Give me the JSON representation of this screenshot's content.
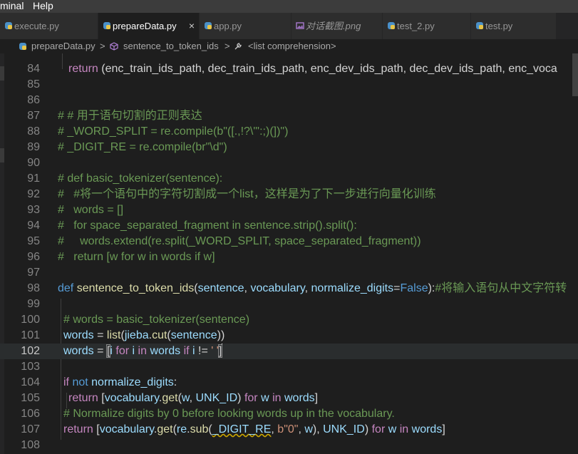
{
  "menu": {
    "terminal": "minal",
    "help": "Help"
  },
  "tabs": [
    {
      "label": "execute.py",
      "icon": "python-icon",
      "active": false
    },
    {
      "label": "prepareData.py",
      "icon": "python-icon",
      "active": true,
      "close": "×"
    },
    {
      "label": "app.py",
      "icon": "python-icon",
      "active": false
    },
    {
      "label": "对话截图.png",
      "icon": "image-file-icon",
      "active": false
    },
    {
      "label": "test_2.py",
      "icon": "python-icon",
      "active": false
    },
    {
      "label": "test.py",
      "icon": "python-icon",
      "active": false
    }
  ],
  "breadcrumb": {
    "file": "prepareData.py",
    "sep1": ">",
    "symbol": "sentence_to_token_ids",
    "sep2": ">",
    "context": "<list comprehension>"
  },
  "editor": {
    "lines": [
      {
        "n": "84",
        "text": "return (enc_train_ids_path, dec_train_ids_path, enc_dev_ids_path, dec_dev_ids_path, enc_voca"
      },
      {
        "n": "85",
        "text": ""
      },
      {
        "n": "86",
        "text": ""
      },
      {
        "n": "87",
        "text": "# # 用于语句切割的正则表达"
      },
      {
        "n": "88",
        "text": "# _WORD_SPLIT = re.compile(b\"([.,!?\\\"':;)(])\")"
      },
      {
        "n": "89",
        "text": "# _DIGIT_RE = re.compile(br\"\\d\")"
      },
      {
        "n": "90",
        "text": ""
      },
      {
        "n": "91",
        "text": "# def basic_tokenizer(sentence):"
      },
      {
        "n": "92",
        "text": "#   #将一个语句中的字符切割成一个list，这样是为了下一步进行向量化训练"
      },
      {
        "n": "93",
        "text": "#   words = []"
      },
      {
        "n": "94",
        "text": "#   for space_separated_fragment in sentence.strip().split():"
      },
      {
        "n": "95",
        "text": "#     words.extend(re.split(_WORD_SPLIT, space_separated_fragment))"
      },
      {
        "n": "96",
        "text": "#   return [w for w in words if w]"
      },
      {
        "n": "97",
        "text": ""
      },
      {
        "n": "98",
        "text": "def sentence_to_token_ids(sentence, vocabulary, normalize_digits=False):#将输入语句从中文字符转"
      },
      {
        "n": "99",
        "text": ""
      },
      {
        "n": "100",
        "text": "# words = basic_tokenizer(sentence)"
      },
      {
        "n": "101",
        "text": "words = list(jieba.cut(sentence))"
      },
      {
        "n": "102",
        "text": "words = [i for i in words if i != ' ']"
      },
      {
        "n": "103",
        "text": ""
      },
      {
        "n": "104",
        "text": "if not normalize_digits:"
      },
      {
        "n": "105",
        "text": "return [vocabulary.get(w, UNK_ID) for w in words]"
      },
      {
        "n": "106",
        "text": "# Normalize digits by 0 before looking words up in the vocabulary."
      },
      {
        "n": "107",
        "text": "return [vocabulary.get(re.sub(_DIGIT_RE, b\"0\", w), UNK_ID) for w in words]"
      },
      {
        "n": "108",
        "text": ""
      }
    ]
  }
}
